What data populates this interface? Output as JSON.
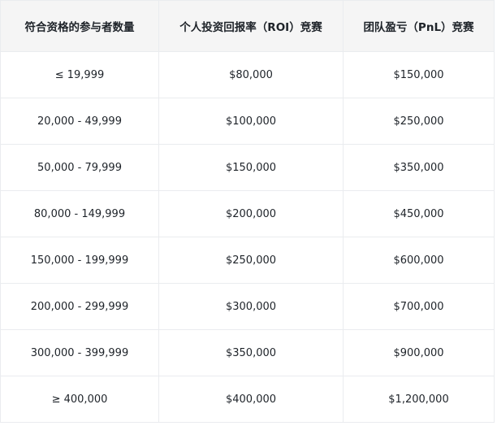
{
  "table": {
    "headers": [
      "符合资格的参与者数量",
      "个人投资回报率（ROI）竞赛",
      "团队盈亏（PnL）竞赛"
    ],
    "rows": [
      {
        "participants": "≤ 19,999",
        "roi": "$80,000",
        "pnl": "$150,000"
      },
      {
        "participants": "20,000 - 49,999",
        "roi": "$100,000",
        "pnl": "$250,000"
      },
      {
        "participants": "50,000 - 79,999",
        "roi": "$150,000",
        "pnl": "$350,000"
      },
      {
        "participants": "80,000 - 149,999",
        "roi": "$200,000",
        "pnl": "$450,000"
      },
      {
        "participants": "150,000 - 199,999",
        "roi": "$250,000",
        "pnl": "$600,000"
      },
      {
        "participants": "200,000 - 299,999",
        "roi": "$300,000",
        "pnl": "$700,000"
      },
      {
        "participants": "300,000 - 399,999",
        "roi": "$350,000",
        "pnl": "$900,000"
      },
      {
        "participants": "≥ 400,000",
        "roi": "$400,000",
        "pnl": "$1,200,000"
      }
    ]
  }
}
